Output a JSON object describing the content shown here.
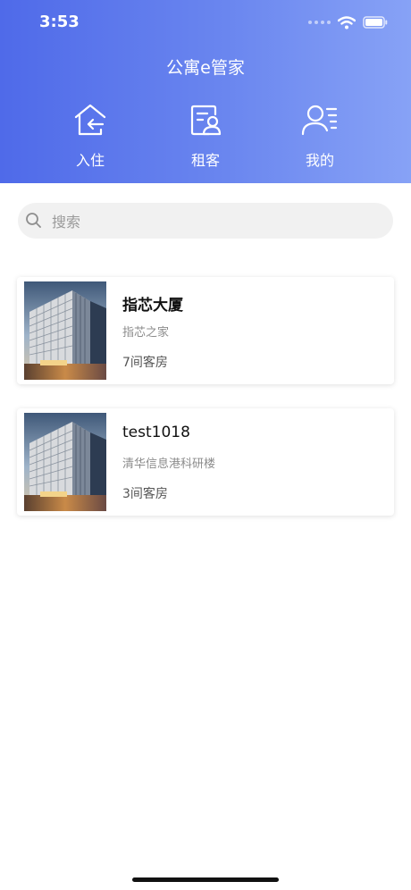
{
  "status_bar": {
    "time": "3:53"
  },
  "header": {
    "title": "公寓e管家",
    "nav": [
      {
        "label": "入住",
        "icon": "home-checkin-icon"
      },
      {
        "label": "租客",
        "icon": "tenant-card-icon"
      },
      {
        "label": "我的",
        "icon": "user-profile-icon"
      }
    ]
  },
  "search": {
    "placeholder": "搜索",
    "value": ""
  },
  "properties": [
    {
      "name": "指芯大厦",
      "subtitle": "指芯之家",
      "rooms": "7间客房"
    },
    {
      "name": "test1018",
      "subtitle": "清华信息港科研楼",
      "rooms": "3间客房"
    }
  ],
  "colors": {
    "header_gradient_start": "#4f6ae9",
    "header_gradient_end": "#87a2f6",
    "search_bg": "#f1f1f1"
  }
}
